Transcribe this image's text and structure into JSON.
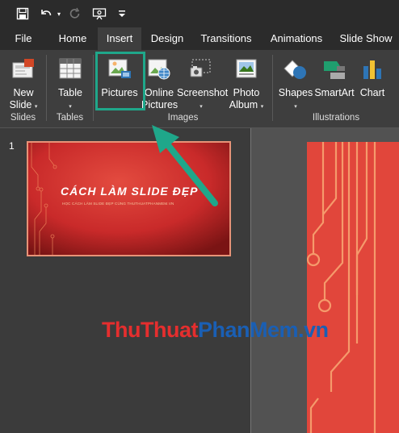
{
  "quick_access": {
    "save_icon": "save-icon",
    "undo_icon": "undo-icon",
    "redo_icon": "redo-icon",
    "present_icon": "present-icon",
    "customize_icon": "customize-icon"
  },
  "tabs": [
    "File",
    "Home",
    "Insert",
    "Design",
    "Transitions",
    "Animations",
    "Slide Show"
  ],
  "active_tab": "Insert",
  "ribbon": {
    "new_slide": {
      "line1": "New",
      "line2": "Slide"
    },
    "table": {
      "line1": "Table"
    },
    "pictures": {
      "line1": "Pictures"
    },
    "online_pictures": {
      "line1": "Online",
      "line2": "Pictures"
    },
    "screenshot": {
      "line1": "Screenshot"
    },
    "photo_album": {
      "line1": "Photo",
      "line2": "Album"
    },
    "shapes": {
      "line1": "Shapes"
    },
    "smartart": {
      "line1": "SmartArt"
    },
    "chart": {
      "line1": "Chart"
    },
    "caret": "▾",
    "groups": {
      "slides": "Slides",
      "tables": "Tables",
      "images": "Images",
      "illustrations": "Illustrations"
    }
  },
  "slide_panel": {
    "slide_number": "1",
    "slide_title": "CÁCH LÀM SLIDE ĐẸP",
    "slide_subtitle": "HỌC CÁCH LÀM SLIDE ĐẸP CÙNG THUTHUATPHANMEM.VN"
  },
  "watermark": {
    "part1": "ThuThuat",
    "part2": "PhanMem",
    "part3": ".vn"
  },
  "colors": {
    "accent_teal": "#1fa78a",
    "slide_red": "#e1463b",
    "watermark_red": "#e52e2e",
    "watermark_blue": "#1a5fb4"
  }
}
